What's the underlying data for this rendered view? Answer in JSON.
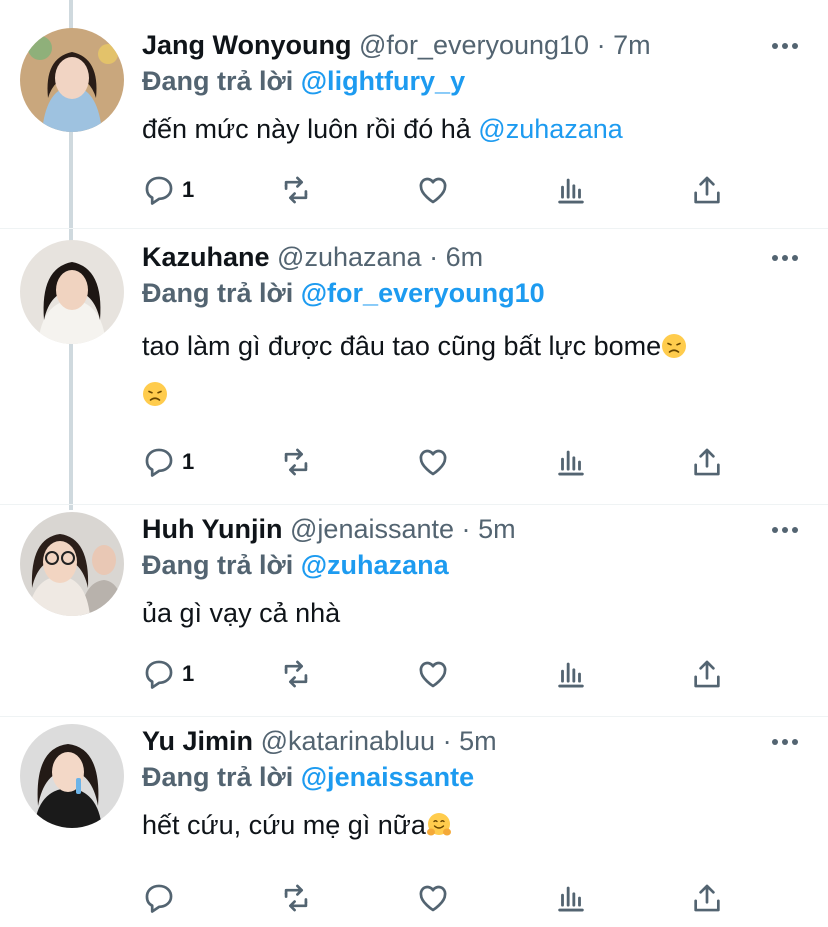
{
  "replying_label": "Đang trả lời",
  "tweets": [
    {
      "name": "Jang Wonyoung",
      "handle": "@for_everyoung10",
      "time": "7m",
      "reply_to": "@lightfury_y",
      "text": "đến mức này luôn rồi đó hả ",
      "mention": "@zuhazana",
      "reply_count": "1"
    },
    {
      "name": "Kazuhane",
      "handle": "@zuhazana",
      "time": "6m",
      "reply_to": "@for_everyoung10",
      "text": "tao làm gì được đâu tao cũng bất lực bome",
      "emoji": "disappointed-face",
      "reply_count": "1"
    },
    {
      "name": "Huh Yunjin",
      "handle": "@jenaissante",
      "time": "5m",
      "reply_to": "@zuhazana",
      "text": "ủa gì vạy cả nhà",
      "reply_count": "1"
    },
    {
      "name": "Yu Jimin",
      "handle": "@katarinabluu",
      "time": "5m",
      "reply_to": "@jenaissante",
      "text": "hết cứu, cứu mẹ gì nữa",
      "emoji": "hugging-face",
      "reply_count": ""
    }
  ],
  "separator": "·",
  "colors": {
    "accent": "#1d9bf0",
    "secondary": "#536471",
    "text": "#0f1419",
    "thread_line": "#cfd9de"
  },
  "action_icons": [
    "reply-icon",
    "retweet-icon",
    "like-icon",
    "analytics-icon",
    "share-icon"
  ]
}
